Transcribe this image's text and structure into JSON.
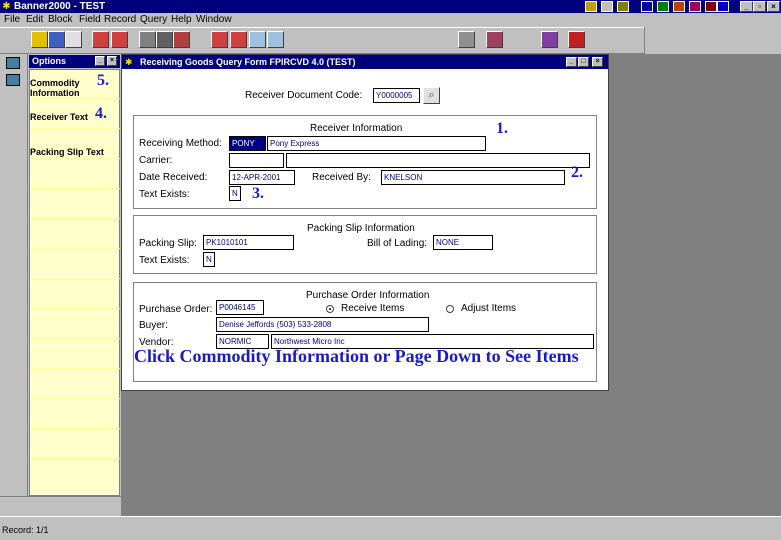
{
  "app": {
    "title": "Banner2000 - TEST"
  },
  "menu": [
    "File",
    "Edit",
    "Block",
    "Field",
    "Record",
    "Query",
    "Help",
    "Window"
  ],
  "options": {
    "title": "Options",
    "items": [
      {
        "label": "Commodity Information",
        "step": "5."
      },
      {
        "label": "Receiver Text",
        "step": "4."
      },
      {
        "label": "Packing Slip Text",
        "step": ""
      }
    ]
  },
  "form": {
    "title": "Receiving Goods Query Form   FPIRCVD  4.0  (TEST)",
    "receiver_doc": {
      "label": "Receiver Document Code:",
      "value": "Y0000005"
    },
    "receiver_info": {
      "heading": "Receiver Information",
      "method_label": "Receiving Method:",
      "method_code": "PONY",
      "method_desc": "Pony Express",
      "carrier_label": "Carrier:",
      "carrier_code": "",
      "carrier_desc": "",
      "date_label": "Date Received:",
      "date_value": "12-APR-2001",
      "received_by_label": "Received By:",
      "received_by_value": "KNELSON",
      "text_exists_label": "Text Exists:",
      "text_exists_value": "N",
      "steps": {
        "one": "1.",
        "two": "2.",
        "three": "3."
      }
    },
    "packing_slip": {
      "heading": "Packing Slip Information",
      "slip_label": "Packing Slip:",
      "slip_value": "PK1010101",
      "bol_label": "Bill of Lading:",
      "bol_value": "NONE",
      "text_exists_label": "Text Exists:",
      "text_exists_value": "N"
    },
    "purchase_order": {
      "heading": "Purchase Order Information",
      "po_label": "Purchase Order:",
      "po_value": "P0046145",
      "receive_items": "Receive Items",
      "adjust_items": "Adjust Items",
      "buyer_label": "Buyer:",
      "buyer_value": "Denise Jeffords   (503) 533-2808",
      "vendor_label": "Vendor:",
      "vendor_code": "NORMIC",
      "vendor_name": "Northwest Micro Inc"
    },
    "instruction": "Click Commodity Information or Page Down to See Items"
  },
  "status": {
    "text": "Record: 1/1"
  },
  "colors": {
    "title_bar": "#00007f",
    "step_marker": "#1a1acc",
    "options_bg": "#ffffcc"
  }
}
